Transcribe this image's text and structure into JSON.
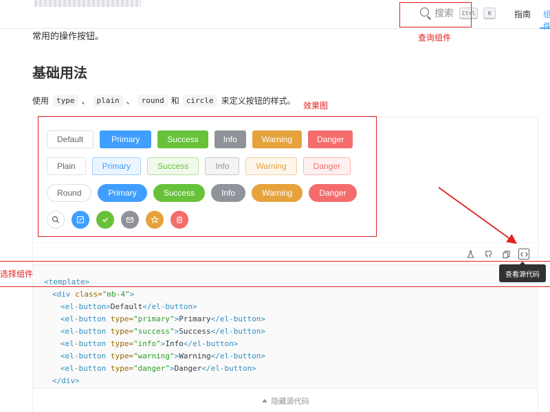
{
  "header": {
    "search_label": "搜索",
    "search_key_1": "Ctrl",
    "search_key_2": "K",
    "nav": [
      {
        "label": "指南"
      },
      {
        "label": "组件"
      }
    ]
  },
  "page": {
    "intro": "常用的操作按钮。",
    "section_title": "基础用法",
    "desc": {
      "prefix": "使用",
      "code_1": "type",
      "sep_1": "、",
      "code_2": "plain",
      "sep_2": "、",
      "code_3": "round",
      "and": "和",
      "code_4": "circle",
      "suffix": "来定义按钮的样式。"
    }
  },
  "demo": {
    "rows": {
      "default": [
        "Default",
        "Primary",
        "Success",
        "Info",
        "Warning",
        "Danger"
      ],
      "plain": [
        "Plain",
        "Primary",
        "Success",
        "Info",
        "Warning",
        "Danger"
      ],
      "round": [
        "Round",
        "Primary",
        "Success",
        "Info",
        "Warning",
        "Danger"
      ]
    },
    "circle_icons": [
      "search-icon",
      "edit-icon",
      "check-icon",
      "message-icon",
      "star-icon",
      "delete-icon"
    ],
    "toolbar_icons": [
      "playground-icon",
      "github-icon",
      "copy-icon",
      "view-source-icon"
    ],
    "tooltip": "查看源代码",
    "hide_label": "隐藏源代码"
  },
  "code": {
    "l1": {
      "t1": "<template>"
    },
    "l2": {
      "t1": "<div",
      "a1": " class=",
      "s1": "\"mb-4\"",
      "t2": ">"
    },
    "l3": {
      "t1": "<el-button>",
      "x1": "Default",
      "t2": "</el-button>"
    },
    "l4": {
      "t1": "<el-button",
      "a1": " type=",
      "s1": "\"primary\"",
      "t2": ">",
      "x1": "Primary",
      "t3": "</el-button>"
    },
    "l5": {
      "t1": "<el-button",
      "a1": " type=",
      "s1": "\"success\"",
      "t2": ">",
      "x1": "Success",
      "t3": "</el-button>"
    },
    "l6": {
      "t1": "<el-button",
      "a1": " type=",
      "s1": "\"info\"",
      "t2": ">",
      "x1": "Info",
      "t3": "</el-button>"
    },
    "l7": {
      "t1": "<el-button",
      "a1": " type=",
      "s1": "\"warning\"",
      "t2": ">",
      "x1": "Warning",
      "t3": "</el-button>"
    },
    "l8": {
      "t1": "<el-button",
      "a1": " type=",
      "s1": "\"danger\"",
      "t2": ">",
      "x1": "Danger",
      "t3": "</el-button>"
    },
    "l9": {
      "t1": "</div>"
    }
  },
  "annotations": {
    "search": "查询组件",
    "effect": "效果图",
    "select": "选择组件",
    "color": "#e02020"
  },
  "colors": {
    "primary": "#409eff",
    "success": "#67c23a",
    "info": "#909399",
    "warning": "#e6a23c",
    "danger": "#f56c6c"
  }
}
